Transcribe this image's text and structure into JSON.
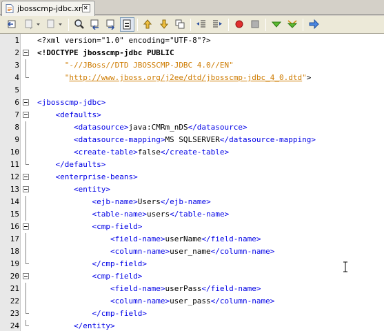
{
  "tab": {
    "label": "jbosscmp-jdbc.xml"
  },
  "editor": {
    "lines": [
      {
        "n": "1",
        "segs": [
          [
            "pi",
            "<?xml version=\"1.0\" encoding=\"UTF-8\"?>"
          ]
        ]
      },
      {
        "n": "2",
        "segs": [
          [
            "dt",
            "<!DOCTYPE jbosscmp-jdbc PUBLIC"
          ]
        ]
      },
      {
        "n": "3",
        "segs": [
          [
            "txt",
            "      "
          ],
          [
            "str",
            "\"-//JBoss//DTD JBOSSCMP-JDBC 4.0//EN\""
          ]
        ]
      },
      {
        "n": "4",
        "segs": [
          [
            "txt",
            "      "
          ],
          [
            "str",
            "\""
          ],
          [
            "url",
            "http://www.jboss.org/j2ee/dtd/jbosscmp-jdbc_4_0.dtd"
          ],
          [
            "str",
            "\""
          ],
          [
            "txt",
            ">"
          ]
        ]
      },
      {
        "n": "5",
        "segs": []
      },
      {
        "n": "6",
        "segs": [
          [
            "tag",
            "<jbosscmp-jdbc>"
          ]
        ]
      },
      {
        "n": "7",
        "segs": [
          [
            "txt",
            "    "
          ],
          [
            "tag",
            "<defaults>"
          ]
        ]
      },
      {
        "n": "8",
        "segs": [
          [
            "txt",
            "        "
          ],
          [
            "tag",
            "<datasource>"
          ],
          [
            "txt",
            "java:CMRm_nDS"
          ],
          [
            "tag",
            "</datasource>"
          ]
        ]
      },
      {
        "n": "9",
        "segs": [
          [
            "txt",
            "        "
          ],
          [
            "tag",
            "<datasource-mapping>"
          ],
          [
            "txt",
            "MS SQLSERVER"
          ],
          [
            "tag",
            "</datasource-mapping>"
          ]
        ]
      },
      {
        "n": "10",
        "segs": [
          [
            "txt",
            "        "
          ],
          [
            "tag",
            "<create-table>"
          ],
          [
            "txt",
            "false"
          ],
          [
            "tag",
            "</create-table>"
          ]
        ]
      },
      {
        "n": "11",
        "segs": [
          [
            "txt",
            "    "
          ],
          [
            "tag",
            "</defaults>"
          ]
        ]
      },
      {
        "n": "12",
        "segs": [
          [
            "txt",
            "    "
          ],
          [
            "tag",
            "<enterprise-beans>"
          ]
        ]
      },
      {
        "n": "13",
        "segs": [
          [
            "txt",
            "        "
          ],
          [
            "tag",
            "<entity>"
          ]
        ]
      },
      {
        "n": "14",
        "segs": [
          [
            "txt",
            "            "
          ],
          [
            "tag",
            "<ejb-name>"
          ],
          [
            "txt",
            "Users"
          ],
          [
            "tag",
            "</ejb-name>"
          ]
        ]
      },
      {
        "n": "15",
        "segs": [
          [
            "txt",
            "            "
          ],
          [
            "tag",
            "<table-name>"
          ],
          [
            "txt",
            "users"
          ],
          [
            "tag",
            "</table-name>"
          ]
        ]
      },
      {
        "n": "16",
        "segs": [
          [
            "txt",
            "            "
          ],
          [
            "tag",
            "<cmp-field>"
          ]
        ]
      },
      {
        "n": "17",
        "segs": [
          [
            "txt",
            "                "
          ],
          [
            "tag",
            "<field-name>"
          ],
          [
            "txt",
            "userName"
          ],
          [
            "tag",
            "</field-name>"
          ]
        ]
      },
      {
        "n": "18",
        "segs": [
          [
            "txt",
            "                "
          ],
          [
            "tag",
            "<column-name>"
          ],
          [
            "txt",
            "user_name"
          ],
          [
            "tag",
            "</column-name>"
          ]
        ]
      },
      {
        "n": "19",
        "segs": [
          [
            "txt",
            "            "
          ],
          [
            "tag",
            "</cmp-field>"
          ]
        ]
      },
      {
        "n": "20",
        "segs": [
          [
            "txt",
            "            "
          ],
          [
            "tag",
            "<cmp-field>"
          ]
        ]
      },
      {
        "n": "21",
        "segs": [
          [
            "txt",
            "                "
          ],
          [
            "tag",
            "<field-name>"
          ],
          [
            "txt",
            "userPass"
          ],
          [
            "tag",
            "</field-name>"
          ]
        ]
      },
      {
        "n": "22",
        "segs": [
          [
            "txt",
            "                "
          ],
          [
            "tag",
            "<column-name>"
          ],
          [
            "txt",
            "user_pass"
          ],
          [
            "tag",
            "</column-name>"
          ]
        ]
      },
      {
        "n": "23",
        "segs": [
          [
            "txt",
            "            "
          ],
          [
            "tag",
            "</cmp-field>"
          ]
        ]
      },
      {
        "n": "24",
        "segs": [
          [
            "txt",
            "        "
          ],
          [
            "tag",
            "</entity>"
          ]
        ]
      }
    ],
    "fold_markers": {
      "open": [
        "2",
        "6",
        "7",
        "12",
        "13",
        "16",
        "20"
      ],
      "end": [
        "4",
        "11",
        "19",
        "23",
        "24"
      ],
      "through": [
        "3",
        "8",
        "9",
        "10",
        "14",
        "15",
        "17",
        "18",
        "21",
        "22"
      ]
    }
  },
  "colors": {
    "tag": "#0000e6",
    "string": "#ce7b00",
    "text": "#000000",
    "gutter": "#e8e8e8"
  }
}
